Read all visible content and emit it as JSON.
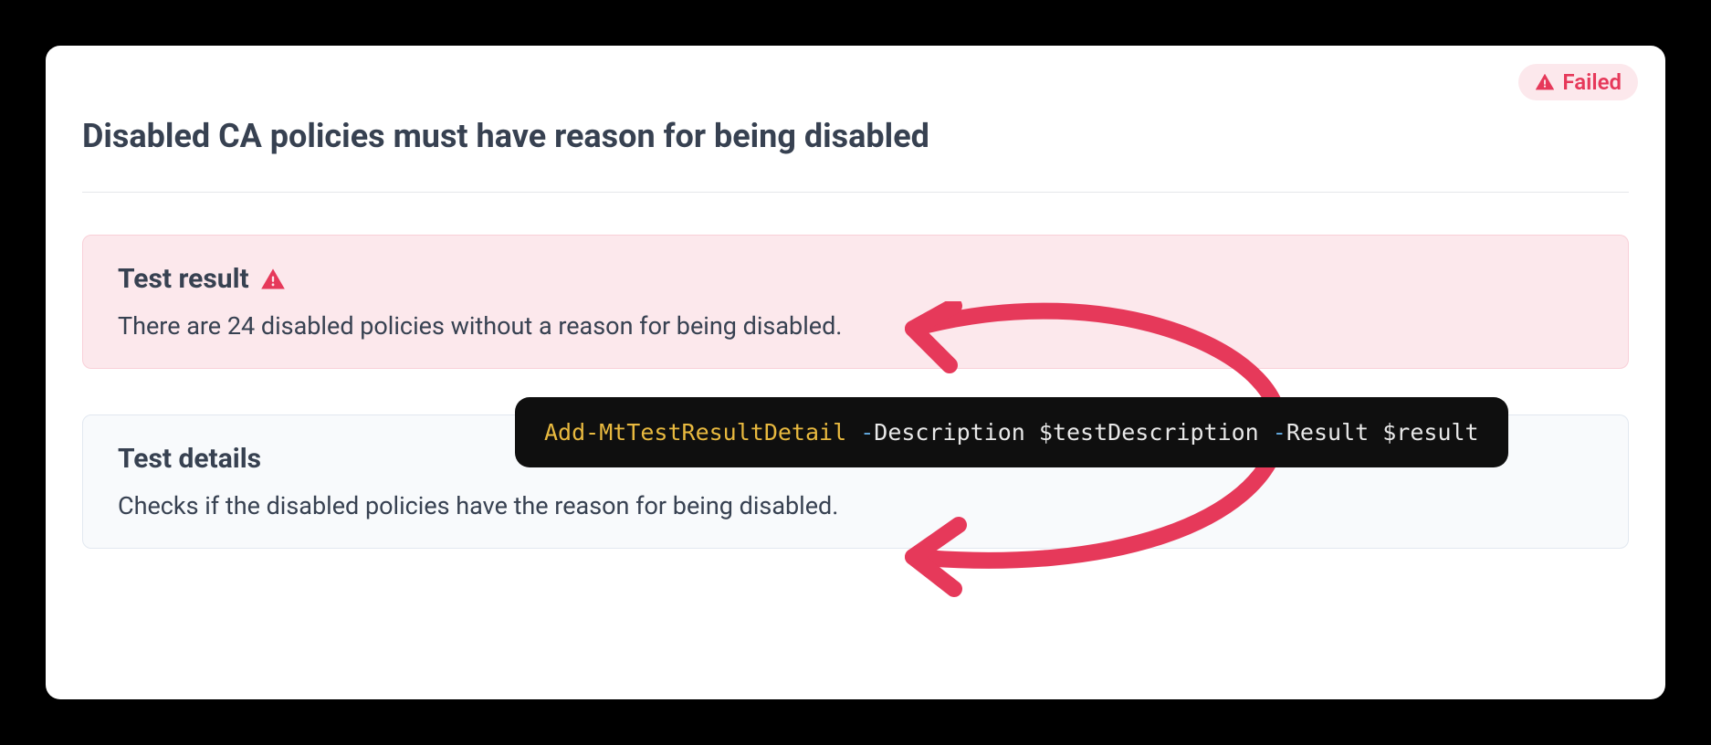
{
  "status": {
    "label": "Failed"
  },
  "card": {
    "title": "Disabled CA policies must have reason for being disabled"
  },
  "result_panel": {
    "title": "Test result",
    "body": "There are 24 disabled policies without a reason for being disabled."
  },
  "details_panel": {
    "title": "Test details",
    "body": "Checks if the disabled policies have the reason for being disabled."
  },
  "code": {
    "cmd": "Add-MtTestResultDetail",
    "param1_flag": "-",
    "param1_name": "Description",
    "param1_value": "$testDescription",
    "param2_flag": "-",
    "param2_name": "Result",
    "param2_value": "$result"
  }
}
